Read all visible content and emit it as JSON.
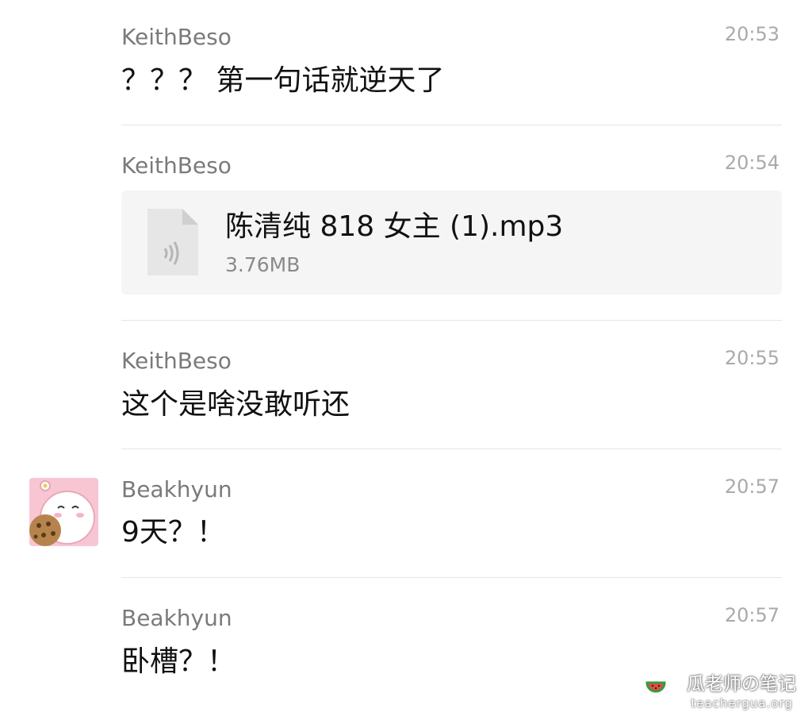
{
  "messages": [
    {
      "sender": "KeithBeso",
      "time": "20:53",
      "text": "？？？ 第一句话就逆天了"
    },
    {
      "sender": "KeithBeso",
      "time": "20:54",
      "file": {
        "name": "陈清纯 818 女主 (1).mp3",
        "size": "3.76MB",
        "icon": "audio-file-icon"
      }
    },
    {
      "sender": "KeithBeso",
      "time": "20:55",
      "text": "这个是啥没敢听还"
    },
    {
      "sender": "Beakhyun",
      "time": "20:57",
      "text": "9天？！",
      "avatar": "cartoon-girl-cookie-avatar"
    },
    {
      "sender": "Beakhyun",
      "time": "20:57",
      "text": "卧槽？！"
    }
  ],
  "watermark": {
    "title": "瓜老师の笔记",
    "url": "teachergua.org",
    "icon": "watermelon-icon"
  },
  "colors": {
    "divider": "#e5e5e5",
    "file_card_bg": "#f5f5f5",
    "sender": "#7a7a7a",
    "time": "#aaaaaa"
  }
}
